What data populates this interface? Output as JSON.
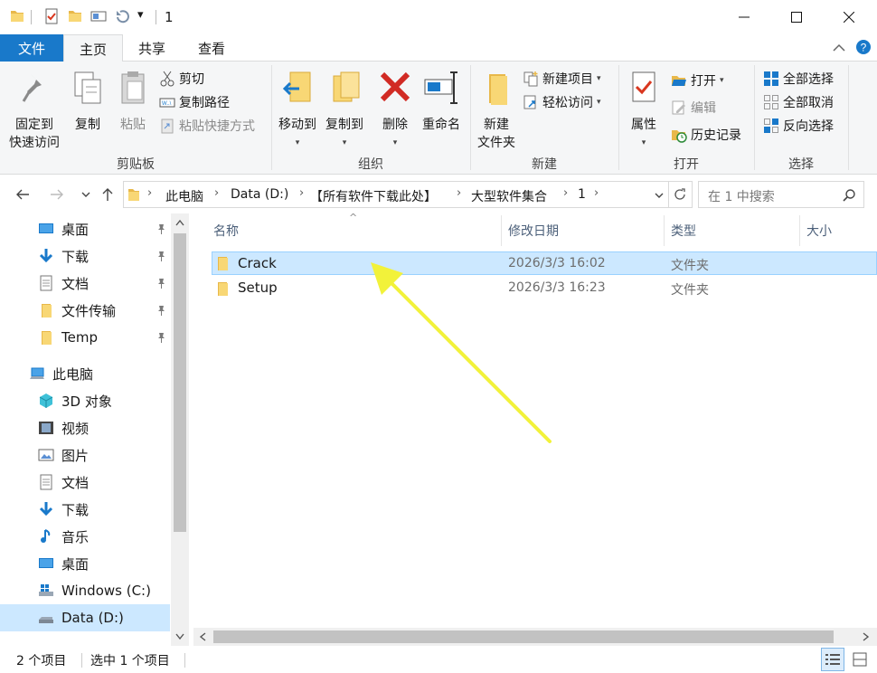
{
  "window": {
    "title": "1",
    "qa_dropdown": "▾"
  },
  "ribbon_tabs": {
    "file": "文件",
    "home": "主页",
    "share": "共享",
    "view": "查看"
  },
  "ribbon": {
    "clipboard": {
      "label": "剪贴板",
      "pin_line1": "固定到",
      "pin_line2": "快速访问",
      "copy": "复制",
      "paste": "粘贴",
      "cut": "剪切",
      "copy_path": "复制路径",
      "paste_shortcut": "粘贴快捷方式"
    },
    "organize": {
      "label": "组织",
      "move_to": "移动到",
      "copy_to": "复制到",
      "delete": "删除",
      "rename": "重命名"
    },
    "new": {
      "label": "新建",
      "new_folder_line1": "新建",
      "new_folder_line2": "文件夹",
      "new_item": "新建项目",
      "easy_access": "轻松访问"
    },
    "open": {
      "label": "打开",
      "properties": "属性",
      "open": "打开",
      "edit": "编辑",
      "history": "历史记录"
    },
    "select": {
      "label": "选择",
      "select_all": "全部选择",
      "select_none": "全部取消",
      "invert": "反向选择"
    }
  },
  "address": {
    "crumbs": [
      "此电脑",
      "Data (D:)",
      "【所有软件下载此处】",
      "大型软件集合",
      "1"
    ],
    "search_placeholder": "在 1 中搜索"
  },
  "nav": {
    "quick_access": [
      {
        "label": "桌面",
        "icon": "desktop-icon"
      },
      {
        "label": "下载",
        "icon": "download-icon"
      },
      {
        "label": "文档",
        "icon": "document-icon"
      },
      {
        "label": "文件传输",
        "icon": "folder-icon"
      },
      {
        "label": "Temp",
        "icon": "folder-icon"
      }
    ],
    "this_pc": "此电脑",
    "pc_items": [
      {
        "label": "3D 对象",
        "icon": "3d-objects-icon"
      },
      {
        "label": "视频",
        "icon": "video-icon"
      },
      {
        "label": "图片",
        "icon": "pictures-icon"
      },
      {
        "label": "文档",
        "icon": "document-icon"
      },
      {
        "label": "下载",
        "icon": "download-icon"
      },
      {
        "label": "音乐",
        "icon": "music-icon"
      },
      {
        "label": "桌面",
        "icon": "desktop-icon"
      },
      {
        "label": "Windows (C:)",
        "icon": "windows-drive-icon"
      },
      {
        "label": "Data (D:)",
        "icon": "drive-icon"
      }
    ]
  },
  "columns": {
    "name": "名称",
    "date": "修改日期",
    "type": "类型",
    "size": "大小"
  },
  "files": [
    {
      "name": "Crack",
      "date": "2026/3/3 16:02",
      "type": "文件夹",
      "selected": true
    },
    {
      "name": "Setup",
      "date": "2026/3/3 16:23",
      "type": "文件夹",
      "selected": false
    }
  ],
  "status": {
    "count": "2 个项目",
    "selected": "选中 1 个项目"
  },
  "colors": {
    "accent": "#1979ca",
    "selection": "#cce8ff",
    "arrow": "#f2f23a"
  }
}
